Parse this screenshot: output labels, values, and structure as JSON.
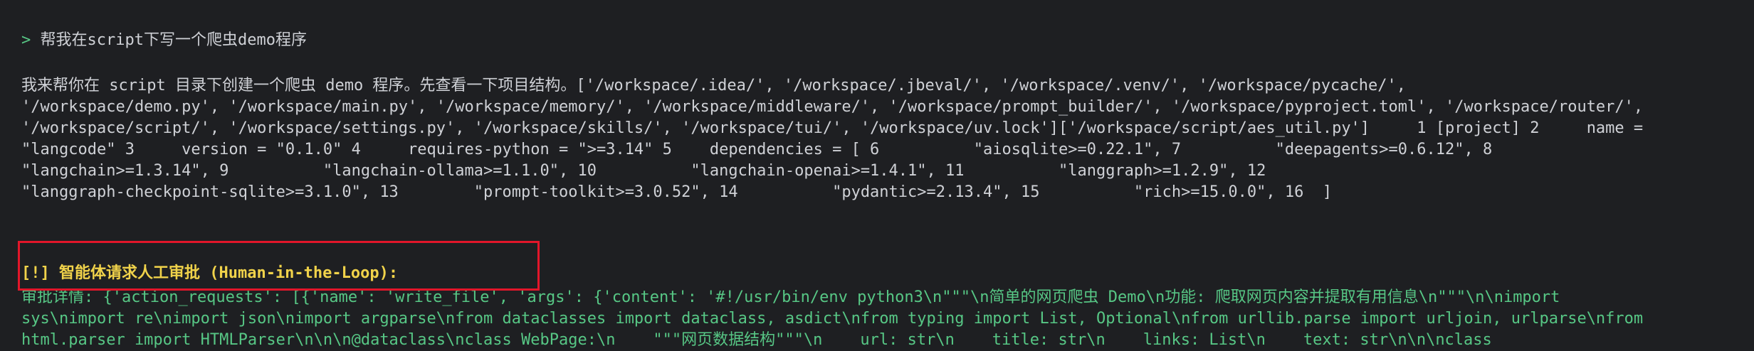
{
  "prompt": {
    "marker": ">",
    "text": "帮我在script下写一个爬虫demo程序"
  },
  "output_lines": [
    "我来帮你在 script 目录下创建一个爬虫 demo 程序。先查看一下项目结构。['/workspace/.idea/', '/workspace/.jbeval/', '/workspace/.venv/', '/workspace/pycache/',",
    "'/workspace/demo.py', '/workspace/main.py', '/workspace/memory/', '/workspace/middleware/', '/workspace/prompt_builder/', '/workspace/pyproject.toml', '/workspace/router/',",
    "'/workspace/script/', '/workspace/settings.py', '/workspace/skills/', '/workspace/tui/', '/workspace/uv.lock']['/workspace/script/aes_util.py']     1 [project] 2     name =",
    "\"langcode\" 3     version = \"0.1.0\" 4     requires-python = \">=3.14\" 5    dependencies = [ 6          \"aiosqlite>=0.22.1\", 7          \"deepagents>=0.6.12\", 8",
    "\"langchain>=1.3.14\", 9          \"langchain-ollama>=1.1.0\", 10          \"langchain-openai>=1.4.1\", 11          \"langgraph>=1.2.9\", 12",
    "\"langgraph-checkpoint-sqlite>=3.1.0\", 13        \"prompt-toolkit>=3.0.52\", 14          \"pydantic>=2.13.4\", 15          \"rich>=15.0.0\", 16  ]"
  ],
  "approval": {
    "title": "[!] 智能体请求人工审批 (Human-in-the-Loop):",
    "detail_lines": [
      "审批详情: {'action_requests': [{'name': 'write_file', 'args': {'content': '#!/usr/bin/env python3\\n\"\"\"\\n简单的网页爬虫 Demo\\n功能: 爬取网页内容并提取有用信息\\n\"\"\"\\n\\nimport",
      "sys\\nimport re\\nimport json\\nimport argparse\\nfrom dataclasses import dataclass, asdict\\nfrom typing import List, Optional\\nfrom urllib.parse import urljoin, urlparse\\nfrom",
      "html.parser import HTMLParser\\n\\n\\n@dataclass\\nclass WebPage:\\n    \"\"\"网页数据结构\"\"\"\\n    url: str\\n    title: str\\n    links: List\\n    text: str\\n\\n\\nclass"
    ]
  },
  "colors": {
    "background": "#1e1f22",
    "text": "#cfd1d6",
    "prompt_marker": "#57c785",
    "warning": "#f0d24a",
    "detail": "#57c785",
    "highlight_border": "#e2162a"
  }
}
